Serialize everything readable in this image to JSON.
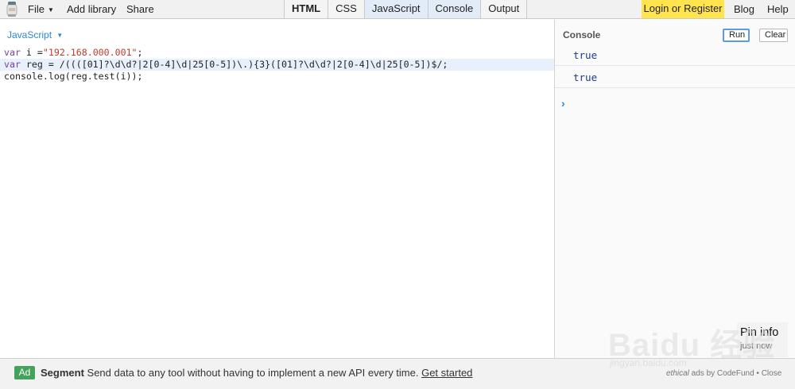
{
  "topbar": {
    "logo_icon": "jsbin-logo-icon",
    "menu": [
      {
        "label": "File",
        "icon": "chevron-down-icon"
      },
      {
        "label": "Add library"
      },
      {
        "label": "Share"
      }
    ],
    "tabs": [
      {
        "label": "HTML",
        "state": "bold"
      },
      {
        "label": "CSS",
        "state": "off"
      },
      {
        "label": "JavaScript",
        "state": "active"
      },
      {
        "label": "Console",
        "state": "active"
      },
      {
        "label": "Output",
        "state": "off"
      }
    ],
    "login_label": "Login or Register",
    "blog_label": "Blog",
    "help_label": "Help",
    "login_color": "#ffe44d"
  },
  "editor": {
    "language": "JavaScript",
    "code_lines": [
      {
        "kw": "var ",
        "rest": "i =",
        "str": "\"192.168.000.001\"",
        "tail": ";"
      },
      {
        "kw": "var ",
        "rest": "reg = /((([01]?\\d\\d?|2[0-4]\\d|25[0-5])\\.){3}([01]?\\d\\d?|2[0-4]\\d|25[0-5])$/;",
        "str": "",
        "tail": ""
      },
      {
        "kw": "",
        "rest": "console.log(reg.test(i));",
        "str": "",
        "tail": ""
      }
    ]
  },
  "console": {
    "title": "Console",
    "run_label": "Run",
    "clear_label": "Clear",
    "outputs": [
      "true",
      "true"
    ],
    "prompt_glyph": "›",
    "pin": {
      "title": "Pin info",
      "subtitle": "just now"
    }
  },
  "ad": {
    "badge": "Ad",
    "brand": "Segment",
    "text": " Send data to any tool without having to implement a new API every time. ",
    "link": "Get started",
    "credit_italic": "ethical",
    "credit_rest": " ads by CodeFund • ",
    "close": "Close"
  },
  "watermark": {
    "brand": "Baidu 经验",
    "url": "jingyan.baidu.com"
  }
}
